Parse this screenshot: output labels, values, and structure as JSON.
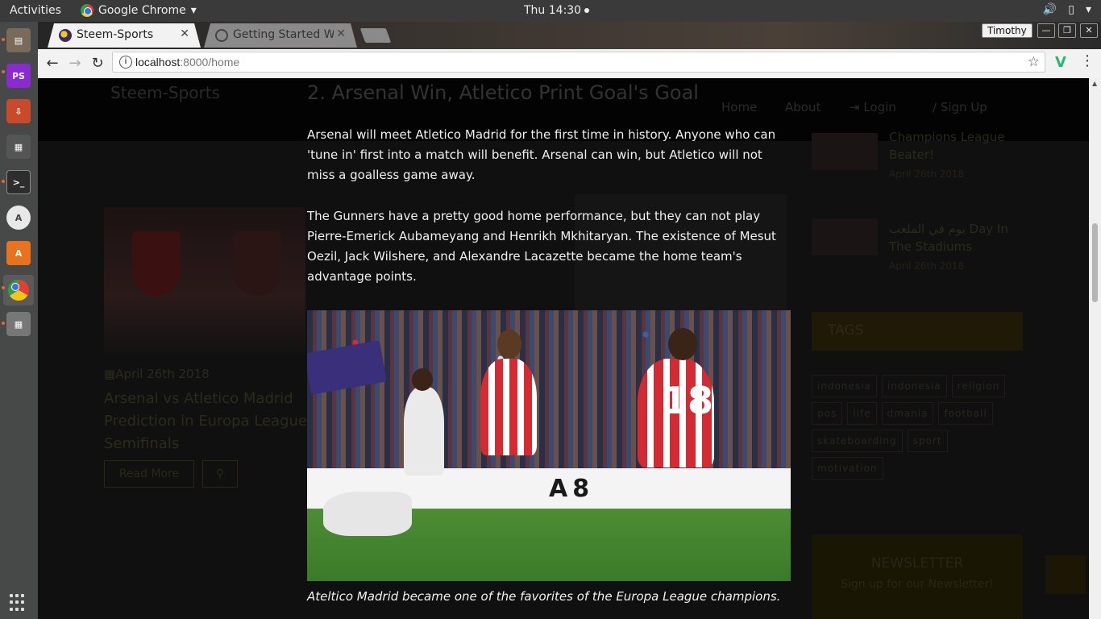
{
  "system": {
    "activities": "Activities",
    "app_name": "Google Chrome",
    "clock": "Thu 14:30",
    "dock_apps": [
      "files",
      "phpstorm",
      "installer",
      "video-editor",
      "terminal",
      "software-updater",
      "app-store",
      "chrome",
      "calculator"
    ]
  },
  "browser": {
    "tabs": [
      {
        "title": "Steem-Sports",
        "active": true
      },
      {
        "title": "Getting Started Wit",
        "active": false
      }
    ],
    "profile": "Timothy",
    "url_host": "localhost",
    "url_rest": ":8000/home"
  },
  "page_bg": {
    "brand": "Steem-Sports",
    "nav": [
      "Home",
      "About",
      "Login",
      "/ Sign Up"
    ],
    "card": {
      "date": "April 26th 2018",
      "title": "Arsenal vs Atletico Madrid Prediction in Europa League Semifinals",
      "read_more": "Read More"
    },
    "sidebar_posts": [
      {
        "title": "Champions League Beater!",
        "date": "April 26th 2018"
      },
      {
        "title": "يوم في الملعب Day In The Stadiums",
        "date": "April 26th 2018"
      }
    ],
    "tags_heading": "TAGS",
    "tags": [
      "indonesia",
      "indonesia",
      "religion",
      "pos",
      "life",
      "dmania",
      "football",
      "skateboarding",
      "sport",
      "motivation"
    ],
    "newsletter": {
      "heading": "NEWSLETTER",
      "subtitle": "Sign up for our Newsletter!"
    }
  },
  "article": {
    "heading": "2. Arsenal Win, Atletico Print Goal's Goal",
    "p1": "Arsenal will meet Atletico Madrid for the first time in history. Anyone who can 'tune in' first into a match will benefit. Arsenal can win, but Atletico will not miss a goalless game away.",
    "p2": "The Gunners have a pretty good home performance, but they can not play Pierre-Emerick Aubameyang and Henrikh Mkhitaryan. The existence of Mesut Oezil, Jack Wilshere, and Alexandre Lacazette became the home team's advantage points.",
    "photo_alt": "Atletico players celebrating on the pitch",
    "photo_board_text": "A8",
    "photo_number": "18",
    "caption": "Ateltico Madrid became one of the favorites of the Europa League champions."
  }
}
